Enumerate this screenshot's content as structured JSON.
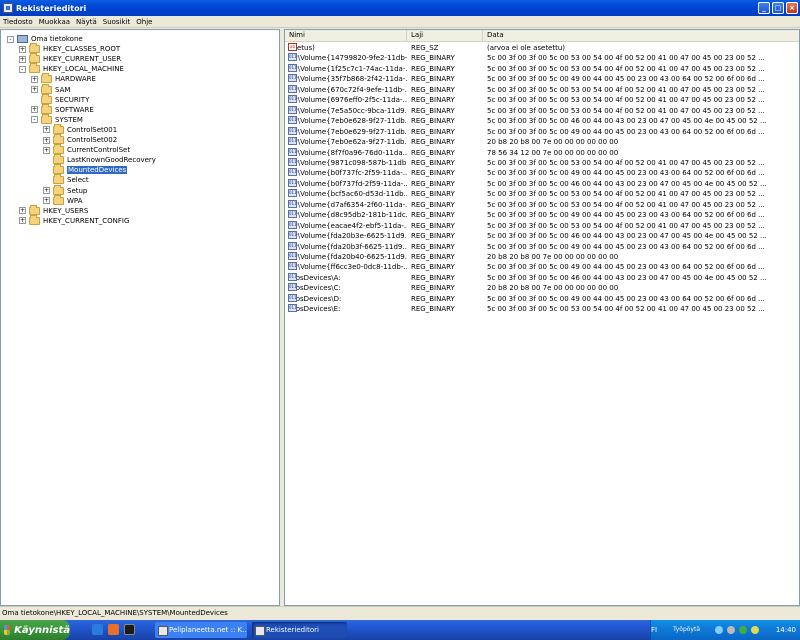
{
  "window": {
    "title": "Rekisterieditori"
  },
  "menu": [
    "Tiedosto",
    "Muokkaa",
    "Näytä",
    "Suosikit",
    "Ohje"
  ],
  "tree": [
    {
      "label": "Oma tietokone",
      "level": 0,
      "icon": "computer",
      "exp": "-"
    },
    {
      "label": "HKEY_CLASSES_ROOT",
      "level": 1,
      "icon": "folder",
      "exp": "+"
    },
    {
      "label": "HKEY_CURRENT_USER",
      "level": 1,
      "icon": "folder",
      "exp": "+"
    },
    {
      "label": "HKEY_LOCAL_MACHINE",
      "level": 1,
      "icon": "folder",
      "exp": "-"
    },
    {
      "label": "HARDWARE",
      "level": 2,
      "icon": "folder",
      "exp": "+"
    },
    {
      "label": "SAM",
      "level": 2,
      "icon": "folder",
      "exp": "+"
    },
    {
      "label": "SECURITY",
      "level": 2,
      "icon": "folder",
      "exp": ""
    },
    {
      "label": "SOFTWARE",
      "level": 2,
      "icon": "folder",
      "exp": "+"
    },
    {
      "label": "SYSTEM",
      "level": 2,
      "icon": "folder",
      "exp": "-"
    },
    {
      "label": "ControlSet001",
      "level": 3,
      "icon": "folder",
      "exp": "+"
    },
    {
      "label": "ControlSet002",
      "level": 3,
      "icon": "folder",
      "exp": "+"
    },
    {
      "label": "CurrentControlSet",
      "level": 3,
      "icon": "folder",
      "exp": "+"
    },
    {
      "label": "LastKnownGoodRecovery",
      "level": 3,
      "icon": "folder",
      "exp": ""
    },
    {
      "label": "MountedDevices",
      "level": 3,
      "icon": "folder",
      "exp": "",
      "selected": true
    },
    {
      "label": "Select",
      "level": 3,
      "icon": "folder",
      "exp": ""
    },
    {
      "label": "Setup",
      "level": 3,
      "icon": "folder",
      "exp": "+"
    },
    {
      "label": "WPA",
      "level": 3,
      "icon": "folder",
      "exp": "+"
    },
    {
      "label": "HKEY_USERS",
      "level": 1,
      "icon": "folder",
      "exp": "+"
    },
    {
      "label": "HKEY_CURRENT_CONFIG",
      "level": 1,
      "icon": "folder",
      "exp": "+"
    }
  ],
  "columns": [
    "Nimi",
    "Laji",
    "Data"
  ],
  "values": [
    {
      "name": "(oletus)",
      "type": "REG_SZ",
      "data": "(arvoa ei ole asetettu)",
      "icon": "ab"
    },
    {
      "name": "\\??\\Volume{14799820-9fe2-11db-...",
      "type": "REG_BINARY",
      "data": "5c 00 3f 00 3f 00 5c 00 53 00 54 00 4f 00 52 00 41 00 47 00 45 00 23 00 52 ...",
      "icon": "bin"
    },
    {
      "name": "\\??\\Volume{1f25c7c1-74ac-11da-...",
      "type": "REG_BINARY",
      "data": "5c 00 3f 00 3f 00 5c 00 53 00 54 00 4f 00 52 00 41 00 47 00 45 00 23 00 52 ...",
      "icon": "bin"
    },
    {
      "name": "\\??\\Volume{35f7b868-2f42-11da-...",
      "type": "REG_BINARY",
      "data": "5c 00 3f 00 3f 00 5c 00 49 00 44 00 45 00 23 00 43 00 64 00 52 00 6f 00 6d ...",
      "icon": "bin"
    },
    {
      "name": "\\??\\Volume{670c72f4-9efe-11db-...",
      "type": "REG_BINARY",
      "data": "5c 00 3f 00 3f 00 5c 00 53 00 54 00 4f 00 52 00 41 00 47 00 45 00 23 00 52 ...",
      "icon": "bin"
    },
    {
      "name": "\\??\\Volume{6976eff0-2f5c-11da-...",
      "type": "REG_BINARY",
      "data": "5c 00 3f 00 3f 00 5c 00 53 00 54 00 4f 00 52 00 41 00 47 00 45 00 23 00 52 ...",
      "icon": "bin"
    },
    {
      "name": "\\??\\Volume{7e5a50cc-9bca-11d9...",
      "type": "REG_BINARY",
      "data": "5c 00 3f 00 3f 00 5c 00 53 00 54 00 4f 00 52 00 41 00 47 00 45 00 23 00 52 ...",
      "icon": "bin"
    },
    {
      "name": "\\??\\Volume{7eb0e628-9f27-11db...",
      "type": "REG_BINARY",
      "data": "5c 00 3f 00 3f 00 5c 00 46 00 44 00 43 00 23 00 47 00 45 00 4e 00 45 00 52 ...",
      "icon": "bin"
    },
    {
      "name": "\\??\\Volume{7eb0e629-9f27-11db...",
      "type": "REG_BINARY",
      "data": "5c 00 3f 00 3f 00 5c 00 49 00 44 00 45 00 23 00 43 00 64 00 52 00 6f 00 6d ...",
      "icon": "bin"
    },
    {
      "name": "\\??\\Volume{7eb0e62a-9f27-11db...",
      "type": "REG_BINARY",
      "data": "20 b8 20 b8 00 7e 00 00 00 00 00 00",
      "icon": "bin"
    },
    {
      "name": "\\??\\Volume{8f7f0a96-76d0-11da...",
      "type": "REG_BINARY",
      "data": "78 56 34 12 00 7e 00 00 00 00 00 00",
      "icon": "bin"
    },
    {
      "name": "\\??\\Volume{9871c098-587b-11db...",
      "type": "REG_BINARY",
      "data": "5c 00 3f 00 3f 00 5c 00 53 00 54 00 4f 00 52 00 41 00 47 00 45 00 23 00 52 ...",
      "icon": "bin"
    },
    {
      "name": "\\??\\Volume{b0f737fc-2f59-11da-...",
      "type": "REG_BINARY",
      "data": "5c 00 3f 00 3f 00 5c 00 49 00 44 00 45 00 23 00 43 00 64 00 52 00 6f 00 6d ...",
      "icon": "bin"
    },
    {
      "name": "\\??\\Volume{b0f737fd-2f59-11da-...",
      "type": "REG_BINARY",
      "data": "5c 00 3f 00 3f 00 5c 00 46 00 44 00 43 00 23 00 47 00 45 00 4e 00 45 00 52 ...",
      "icon": "bin"
    },
    {
      "name": "\\??\\Volume{bcf5ac60-d53d-11db...",
      "type": "REG_BINARY",
      "data": "5c 00 3f 00 3f 00 5c 00 53 00 54 00 4f 00 52 00 41 00 47 00 45 00 23 00 52 ...",
      "icon": "bin"
    },
    {
      "name": "\\??\\Volume{d7af6354-2f60-11da-...",
      "type": "REG_BINARY",
      "data": "5c 00 3f 00 3f 00 5c 00 53 00 54 00 4f 00 52 00 41 00 47 00 45 00 23 00 52 ...",
      "icon": "bin"
    },
    {
      "name": "\\??\\Volume{d8c95db2-181b-11dc...",
      "type": "REG_BINARY",
      "data": "5c 00 3f 00 3f 00 5c 00 49 00 44 00 45 00 23 00 43 00 64 00 52 00 6f 00 6d ...",
      "icon": "bin"
    },
    {
      "name": "\\??\\Volume{eacae4f2-ebf5-11da-...",
      "type": "REG_BINARY",
      "data": "5c 00 3f 00 3f 00 5c 00 53 00 54 00 4f 00 52 00 41 00 47 00 45 00 23 00 52 ...",
      "icon": "bin"
    },
    {
      "name": "\\??\\Volume{fda20b3e-6625-11d9...",
      "type": "REG_BINARY",
      "data": "5c 00 3f 00 3f 00 5c 00 46 00 44 00 43 00 23 00 47 00 45 00 4e 00 45 00 52 ...",
      "icon": "bin"
    },
    {
      "name": "\\??\\Volume{fda20b3f-6625-11d9...",
      "type": "REG_BINARY",
      "data": "5c 00 3f 00 3f 00 5c 00 49 00 44 00 45 00 23 00 43 00 64 00 52 00 6f 00 6d ...",
      "icon": "bin"
    },
    {
      "name": "\\??\\Volume{fda20b40-6625-11d9...",
      "type": "REG_BINARY",
      "data": "20 b8 20 b8 00 7e 00 00 00 00 00 00",
      "icon": "bin"
    },
    {
      "name": "\\??\\Volume{ff6cc3e0-0dc8-11db-...",
      "type": "REG_BINARY",
      "data": "5c 00 3f 00 3f 00 5c 00 49 00 44 00 45 00 23 00 43 00 64 00 52 00 6f 00 6d ...",
      "icon": "bin"
    },
    {
      "name": "\\DosDevices\\A:",
      "type": "REG_BINARY",
      "data": "5c 00 3f 00 3f 00 5c 00 46 00 44 00 43 00 23 00 47 00 45 00 4e 00 45 00 52 ...",
      "icon": "bin"
    },
    {
      "name": "\\DosDevices\\C:",
      "type": "REG_BINARY",
      "data": "20 b8 20 b8 00 7e 00 00 00 00 00 00",
      "icon": "bin"
    },
    {
      "name": "\\DosDevices\\D:",
      "type": "REG_BINARY",
      "data": "5c 00 3f 00 3f 00 5c 00 49 00 44 00 45 00 23 00 43 00 64 00 52 00 6f 00 6d ...",
      "icon": "bin"
    },
    {
      "name": "\\DosDevices\\E:",
      "type": "REG_BINARY",
      "data": "5c 00 3f 00 3f 00 5c 00 53 00 54 00 4f 00 52 00 41 00 47 00 45 00 23 00 52 ...",
      "icon": "bin"
    }
  ],
  "status": "Oma tietokone\\HKEY_LOCAL_MACHINE\\SYSTEM\\MountedDevices",
  "taskbar": {
    "start": "Käynnistä",
    "tasks": [
      "Peliplaneetta.net :: K...",
      "Rekisterieditori"
    ],
    "tray_lang": "FI",
    "tray_desktop": "Työpöytä",
    "clock": "14:40"
  },
  "colors": {
    "selection": "#316AC5",
    "title_blue": "#0046D5",
    "start_green": "#3C9A3C"
  }
}
